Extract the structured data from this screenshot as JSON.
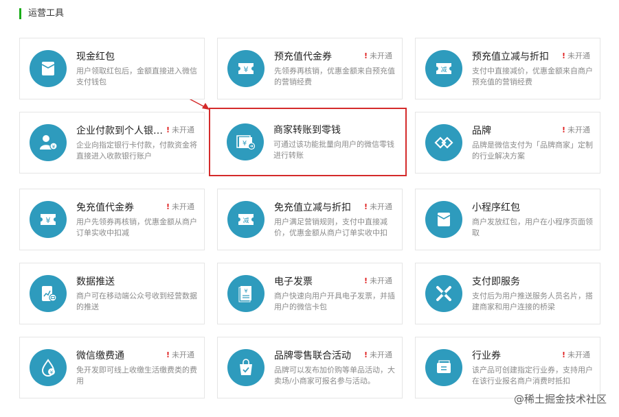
{
  "section": {
    "title": "运营工具"
  },
  "cards": [
    {
      "name": "现金红包",
      "desc": "用户领取红包后，金额直接进入微信支付钱包",
      "status": "",
      "icon": "envelope-icon"
    },
    {
      "name": "预充值代金券",
      "desc": "先领券再核销，优惠金额来自预充值的营销经费",
      "status": "未开通",
      "icon": "voucher-yen-icon"
    },
    {
      "name": "预充值立减与折扣",
      "desc": "支付中直接减价，优惠金额来自商户预充值的营销经费",
      "status": "未开通",
      "icon": "discount-ticket-icon"
    },
    {
      "name": "企业付款到个人银…",
      "desc": "企业向指定银行卡付款，付款资金将直接进入收款银行账户",
      "status": "未开通",
      "icon": "enterprise-payment-icon"
    },
    {
      "name": "商家转账到零钱",
      "desc": "可通过该功能批量向用户的微信零钱进行转账",
      "status": "",
      "icon": "transfer-yen-icon"
    },
    {
      "name": "品牌",
      "desc": "品牌是微信支付为「品牌商家」定制的行业解决方案",
      "status": "未开通",
      "icon": "brand-icon"
    },
    {
      "name": "免充值代金券",
      "desc": "用户先领券再核销，优惠金额从商户订单实收中扣减",
      "status": "未开通",
      "icon": "voucher-yen-icon"
    },
    {
      "name": "免充值立减与折扣",
      "desc": "用户满足营销规则，支付中直接减价，优惠金额从商户订单实收中扣",
      "status": "未开通",
      "icon": "discount-ticket-icon"
    },
    {
      "name": "小程序红包",
      "desc": "商户发放红包，用户在小程序页面领取",
      "status": "",
      "icon": "envelope-icon"
    },
    {
      "name": "数据推送",
      "desc": "商户可在移动端公众号收到经营数据的推送",
      "status": "",
      "icon": "data-push-icon"
    },
    {
      "name": "电子发票",
      "desc": "商户快速向用户开具电子发票，并插用户的微信卡包",
      "status": "未开通",
      "icon": "invoice-icon"
    },
    {
      "name": "支付即服务",
      "desc": "支付后为用户推送服务人员名片，搭建商家和用户连接的桥梁",
      "status": "",
      "icon": "service-icon"
    },
    {
      "name": "微信缴费通",
      "desc": "免开发即可线上收缴生活缴费类的费用",
      "status": "未开通",
      "icon": "fee-payment-icon"
    },
    {
      "name": "品牌零售联合活动",
      "desc": "品牌可以发布加价购等单品活动，大卖场/小商家可报名参与活动。",
      "status": "未开通",
      "icon": "shopping-bag-icon"
    },
    {
      "name": "行业券",
      "desc": "该产品可创建指定行业券，支持用户在该行业报名商户消费时抵扣",
      "status": "未开通",
      "icon": "industry-voucher-icon"
    }
  ],
  "watermark": {
    "text": "@稀土掘金技术社区"
  },
  "colors": {
    "accent": "#1aad19",
    "icon_bg": "#2e9bbd",
    "highlight": "#d42a2a",
    "warning": "#e02020"
  }
}
